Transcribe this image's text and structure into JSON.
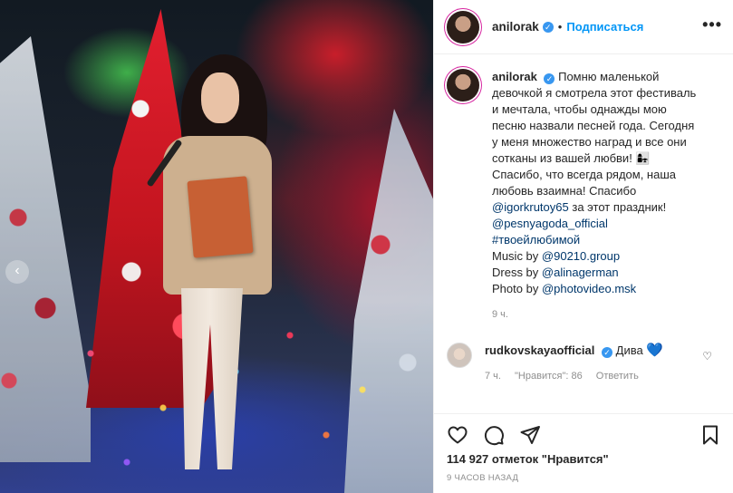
{
  "post": {
    "username": "anilorak",
    "follow_label": "Подписаться",
    "more_label": "•••",
    "prev_arrow": "‹"
  },
  "caption": {
    "username": "anilorak",
    "text_1": "Помню маленькой девочкой я смотрела этот фестиваль и мечтала, чтобы однажды мою песню назвали песней года. Сегодня у меня множество наград и все они сотканы из вашей любви! 👩‍👧 Спасибо, что всегда рядом, наша любовь взаимна! Спасибо ",
    "mention_1": "@igorkrutoy65",
    "text_2": " за этот праздник!",
    "mention_2": "@pesnyagoda_official",
    "hashtag": "#твоейлюбимой",
    "music_prefix": "Music by ",
    "music_mention": "@90210.group",
    "dress_prefix": "Dress by ",
    "dress_mention": "@alinagerman",
    "photo_prefix": "Photo by ",
    "photo_mention": "@photovideo.msk",
    "time": "9 ч."
  },
  "comments": [
    {
      "username": "rudkovskayaofficial",
      "text": "Дива ",
      "emoji": "💙",
      "time": "7 ч.",
      "likes": "\"Нравится\": 86",
      "reply_label": "Ответить"
    }
  ],
  "footer": {
    "likes": "114 927 отметок \"Нравится\"",
    "ago": "9 ЧАСОВ НАЗАД"
  },
  "icons": [
    "heart-icon",
    "comment-icon",
    "share-icon",
    "bookmark-icon",
    "verified-icon",
    "more-icon",
    "chevron-left-icon"
  ],
  "colors": {
    "accent": "#0095f6",
    "verified": "#3897f0",
    "link": "#00376b",
    "muted": "#8e8e8e"
  }
}
